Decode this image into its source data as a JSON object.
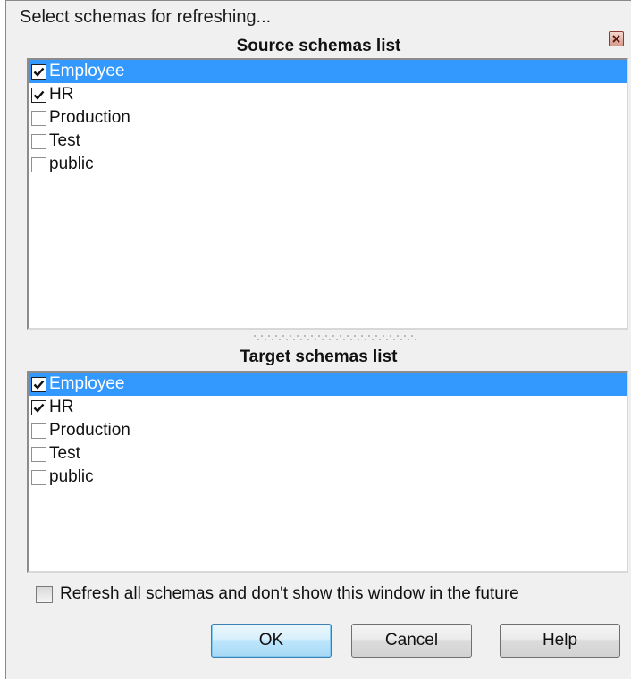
{
  "window": {
    "title": "Select schemas for refreshing...",
    "close_icon": "close-icon"
  },
  "source": {
    "title": "Source schemas list",
    "items": [
      {
        "label": "Employee",
        "checked": true,
        "selected": true
      },
      {
        "label": "HR",
        "checked": true,
        "selected": false
      },
      {
        "label": "Production",
        "checked": false,
        "selected": false
      },
      {
        "label": "Test",
        "checked": false,
        "selected": false
      },
      {
        "label": "public",
        "checked": false,
        "selected": false
      }
    ]
  },
  "target": {
    "title": "Target schemas list",
    "items": [
      {
        "label": "Employee",
        "checked": true,
        "selected": true
      },
      {
        "label": "HR",
        "checked": true,
        "selected": false
      },
      {
        "label": "Production",
        "checked": false,
        "selected": false
      },
      {
        "label": "Test",
        "checked": false,
        "selected": false
      },
      {
        "label": "public",
        "checked": false,
        "selected": false
      }
    ]
  },
  "footer": {
    "refresh_all_label": "Refresh all schemas and don't show this window in the future",
    "refresh_all_checked": false
  },
  "buttons": {
    "ok": "OK",
    "cancel": "Cancel",
    "help": "Help"
  },
  "colors": {
    "selection": "#3399ff",
    "dialog_bg": "#f0f0f0"
  }
}
